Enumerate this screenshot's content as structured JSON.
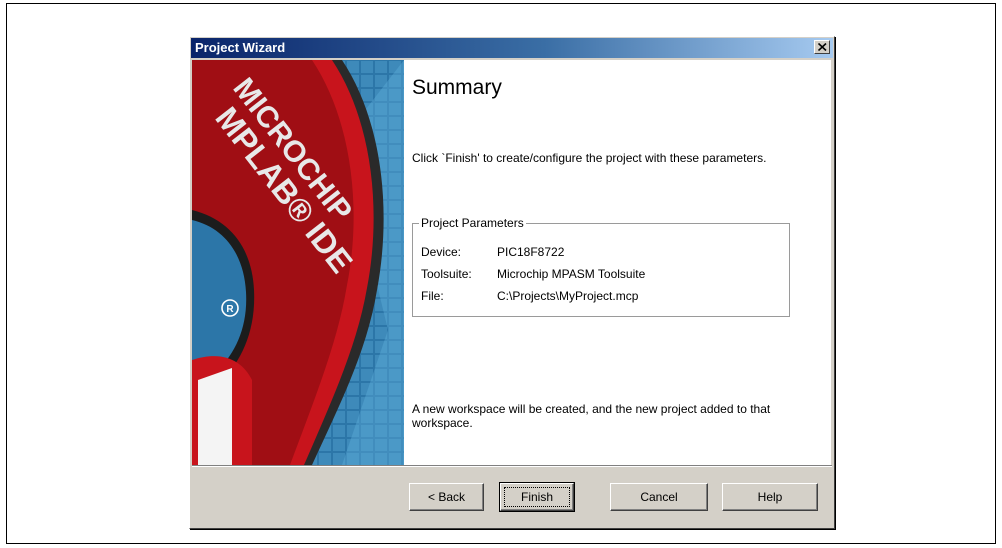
{
  "window": {
    "title": "Project Wizard"
  },
  "banner": {
    "logo_text_1": "MICROCHIP",
    "logo_text_2": "MPLAB® IDE"
  },
  "summary": {
    "heading": "Summary",
    "intro": "Click `Finish' to create/configure the project with these parameters.",
    "group_title": "Project Parameters",
    "params": [
      {
        "key": "Device:",
        "value": "PIC18F8722"
      },
      {
        "key": "Toolsuite:",
        "value": "Microchip MPASM Toolsuite"
      },
      {
        "key": "File:",
        "value": "C:\\Projects\\MyProject.mcp"
      }
    ],
    "footer": "A new workspace will be created, and the new project added to that workspace."
  },
  "buttons": {
    "back": "< Back",
    "finish": "Finish",
    "cancel": "Cancel",
    "help": "Help"
  },
  "icons": {
    "close": "close-icon"
  },
  "colors": {
    "title_bar_start": "#0a246a",
    "title_bar_end": "#a6caf0",
    "dialog_face": "#d4d0c8",
    "banner_blue": "#2c76a8",
    "banner_red": "#c8141c"
  }
}
